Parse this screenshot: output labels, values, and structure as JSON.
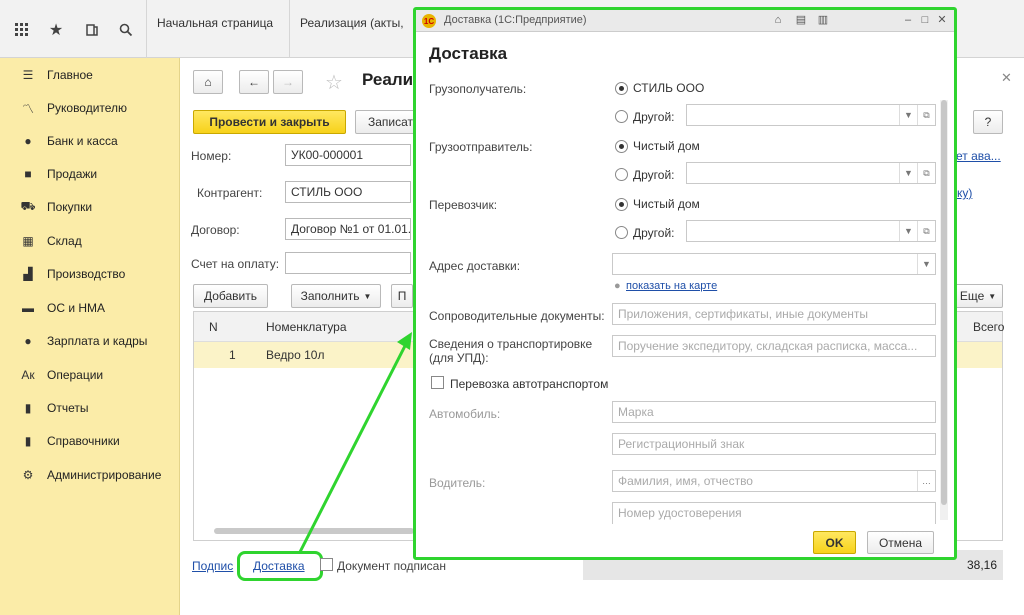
{
  "topbar": {
    "tabs": [
      {
        "label": "Начальная страница"
      },
      {
        "label": "Реализация (акты,"
      }
    ]
  },
  "sidebar": {
    "items": [
      {
        "label": "Главное",
        "icon": "menu-icon"
      },
      {
        "label": "Руководителю",
        "icon": "trend-icon"
      },
      {
        "label": "Банк и касса",
        "icon": "money-icon"
      },
      {
        "label": "Продажи",
        "icon": "bag-icon"
      },
      {
        "label": "Покупки",
        "icon": "cart-icon"
      },
      {
        "label": "Склад",
        "icon": "warehouse-icon"
      },
      {
        "label": "Производство",
        "icon": "factory-icon"
      },
      {
        "label": "ОС и НМА",
        "icon": "truck-icon"
      },
      {
        "label": "Зарплата и кадры",
        "icon": "person-icon"
      },
      {
        "label": "Операции",
        "icon": "operations-icon"
      },
      {
        "label": "Отчеты",
        "icon": "chart-icon"
      },
      {
        "label": "Справочники",
        "icon": "books-icon"
      },
      {
        "label": "Администрирование",
        "icon": "gear-icon"
      }
    ]
  },
  "doc": {
    "title": "Реали",
    "post_close": "Провести и закрыть",
    "save": "Записат",
    "help": "?",
    "number_label": "Номер:",
    "number_value": "УК00-000001",
    "contractor_label": "Контрагент:",
    "contractor_value": "СТИЛЬ ООО",
    "contract_label": "Договор:",
    "contract_value": "Договор №1 от 01.01.",
    "invoice_label": "Счет на оплату:",
    "add": "Добавить",
    "fill": "Заполнить",
    "more": "Еще",
    "col_n": "N",
    "col_nom": "Номенклатура",
    "col_total": "Всего",
    "row_n": "1",
    "row_nom": "Ведро 10л",
    "right_link1": "ет ава...",
    "right_link2": "ку)",
    "sign_link": "Подпис",
    "delivery_link": "Доставка",
    "signed_label": "Документ подписан",
    "total_value": "38,16"
  },
  "dialog": {
    "window_title": "Доставка  (1С:Предприятие)",
    "heading": "Доставка",
    "consignee_label": "Грузополучатель:",
    "consignee_value": "СТИЛЬ ООО",
    "other": "Другой:",
    "shipper_label": "Грузоотправитель:",
    "shipper_value": "Чистый дом",
    "carrier_label": "Перевозчик:",
    "carrier_value": "Чистый дом",
    "address_label": "Адрес доставки:",
    "map_link": "показать на карте",
    "docs_label": "Сопроводительные документы:",
    "docs_placeholder": "Приложения, сертификаты, иные документы",
    "transport_label_1": "Сведения о транспортировке",
    "transport_label_2": "(для УПД):",
    "transport_placeholder": "Поручение экспедитору, складская расписка, масса...",
    "auto_check_label": "Перевозка автотранспортом",
    "car_label": "Автомобиль:",
    "brand_placeholder": "Марка",
    "reg_placeholder": "Регистрационный знак",
    "driver_label": "Водитель:",
    "fio_placeholder": "Фамилия, имя, отчество",
    "license_placeholder": "Номер удостоверения",
    "ok": "OK",
    "cancel": "Отмена"
  }
}
